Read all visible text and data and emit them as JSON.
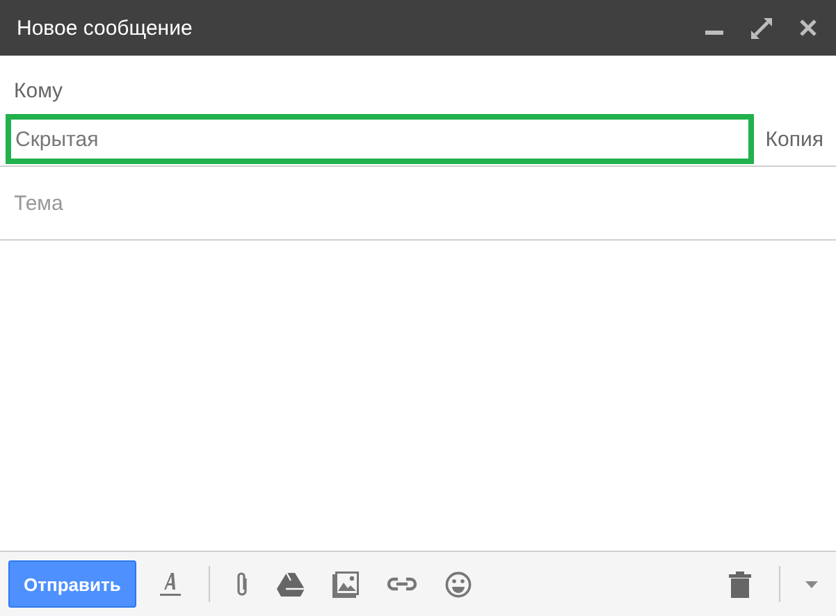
{
  "window": {
    "title": "Новое сообщение"
  },
  "recipients": {
    "to_label": "Кому",
    "bcc": {
      "label": "Скрытая",
      "highlighted": true
    },
    "cc_link": "Копия"
  },
  "subject": {
    "placeholder": "Тема"
  },
  "toolbar": {
    "send_button": "Отправить"
  }
}
